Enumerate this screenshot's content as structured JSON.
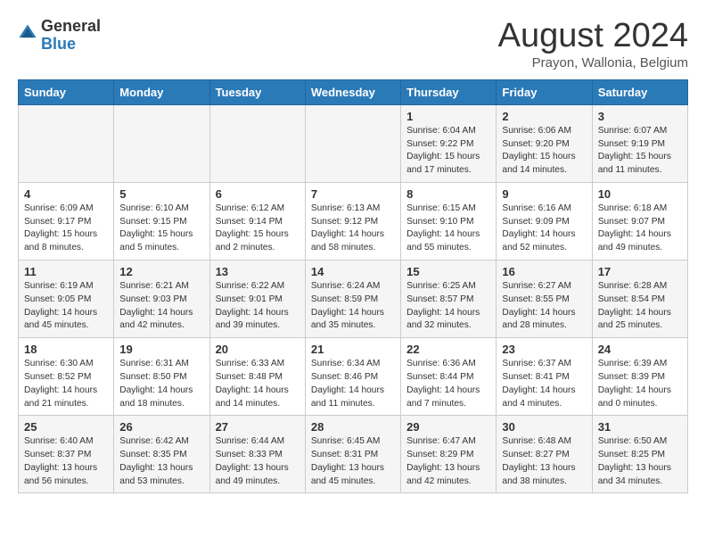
{
  "header": {
    "logo": {
      "general": "General",
      "blue": "Blue"
    },
    "title": "August 2024",
    "subtitle": "Prayon, Wallonia, Belgium"
  },
  "calendar": {
    "weekdays": [
      "Sunday",
      "Monday",
      "Tuesday",
      "Wednesday",
      "Thursday",
      "Friday",
      "Saturday"
    ],
    "weeks": [
      [
        {
          "day": "",
          "info": ""
        },
        {
          "day": "",
          "info": ""
        },
        {
          "day": "",
          "info": ""
        },
        {
          "day": "",
          "info": ""
        },
        {
          "day": "1",
          "info": "Sunrise: 6:04 AM\nSunset: 9:22 PM\nDaylight: 15 hours\nand 17 minutes."
        },
        {
          "day": "2",
          "info": "Sunrise: 6:06 AM\nSunset: 9:20 PM\nDaylight: 15 hours\nand 14 minutes."
        },
        {
          "day": "3",
          "info": "Sunrise: 6:07 AM\nSunset: 9:19 PM\nDaylight: 15 hours\nand 11 minutes."
        }
      ],
      [
        {
          "day": "4",
          "info": "Sunrise: 6:09 AM\nSunset: 9:17 PM\nDaylight: 15 hours\nand 8 minutes."
        },
        {
          "day": "5",
          "info": "Sunrise: 6:10 AM\nSunset: 9:15 PM\nDaylight: 15 hours\nand 5 minutes."
        },
        {
          "day": "6",
          "info": "Sunrise: 6:12 AM\nSunset: 9:14 PM\nDaylight: 15 hours\nand 2 minutes."
        },
        {
          "day": "7",
          "info": "Sunrise: 6:13 AM\nSunset: 9:12 PM\nDaylight: 14 hours\nand 58 minutes."
        },
        {
          "day": "8",
          "info": "Sunrise: 6:15 AM\nSunset: 9:10 PM\nDaylight: 14 hours\nand 55 minutes."
        },
        {
          "day": "9",
          "info": "Sunrise: 6:16 AM\nSunset: 9:09 PM\nDaylight: 14 hours\nand 52 minutes."
        },
        {
          "day": "10",
          "info": "Sunrise: 6:18 AM\nSunset: 9:07 PM\nDaylight: 14 hours\nand 49 minutes."
        }
      ],
      [
        {
          "day": "11",
          "info": "Sunrise: 6:19 AM\nSunset: 9:05 PM\nDaylight: 14 hours\nand 45 minutes."
        },
        {
          "day": "12",
          "info": "Sunrise: 6:21 AM\nSunset: 9:03 PM\nDaylight: 14 hours\nand 42 minutes."
        },
        {
          "day": "13",
          "info": "Sunrise: 6:22 AM\nSunset: 9:01 PM\nDaylight: 14 hours\nand 39 minutes."
        },
        {
          "day": "14",
          "info": "Sunrise: 6:24 AM\nSunset: 8:59 PM\nDaylight: 14 hours\nand 35 minutes."
        },
        {
          "day": "15",
          "info": "Sunrise: 6:25 AM\nSunset: 8:57 PM\nDaylight: 14 hours\nand 32 minutes."
        },
        {
          "day": "16",
          "info": "Sunrise: 6:27 AM\nSunset: 8:55 PM\nDaylight: 14 hours\nand 28 minutes."
        },
        {
          "day": "17",
          "info": "Sunrise: 6:28 AM\nSunset: 8:54 PM\nDaylight: 14 hours\nand 25 minutes."
        }
      ],
      [
        {
          "day": "18",
          "info": "Sunrise: 6:30 AM\nSunset: 8:52 PM\nDaylight: 14 hours\nand 21 minutes."
        },
        {
          "day": "19",
          "info": "Sunrise: 6:31 AM\nSunset: 8:50 PM\nDaylight: 14 hours\nand 18 minutes."
        },
        {
          "day": "20",
          "info": "Sunrise: 6:33 AM\nSunset: 8:48 PM\nDaylight: 14 hours\nand 14 minutes."
        },
        {
          "day": "21",
          "info": "Sunrise: 6:34 AM\nSunset: 8:46 PM\nDaylight: 14 hours\nand 11 minutes."
        },
        {
          "day": "22",
          "info": "Sunrise: 6:36 AM\nSunset: 8:44 PM\nDaylight: 14 hours\nand 7 minutes."
        },
        {
          "day": "23",
          "info": "Sunrise: 6:37 AM\nSunset: 8:41 PM\nDaylight: 14 hours\nand 4 minutes."
        },
        {
          "day": "24",
          "info": "Sunrise: 6:39 AM\nSunset: 8:39 PM\nDaylight: 14 hours\nand 0 minutes."
        }
      ],
      [
        {
          "day": "25",
          "info": "Sunrise: 6:40 AM\nSunset: 8:37 PM\nDaylight: 13 hours\nand 56 minutes."
        },
        {
          "day": "26",
          "info": "Sunrise: 6:42 AM\nSunset: 8:35 PM\nDaylight: 13 hours\nand 53 minutes."
        },
        {
          "day": "27",
          "info": "Sunrise: 6:44 AM\nSunset: 8:33 PM\nDaylight: 13 hours\nand 49 minutes."
        },
        {
          "day": "28",
          "info": "Sunrise: 6:45 AM\nSunset: 8:31 PM\nDaylight: 13 hours\nand 45 minutes."
        },
        {
          "day": "29",
          "info": "Sunrise: 6:47 AM\nSunset: 8:29 PM\nDaylight: 13 hours\nand 42 minutes."
        },
        {
          "day": "30",
          "info": "Sunrise: 6:48 AM\nSunset: 8:27 PM\nDaylight: 13 hours\nand 38 minutes."
        },
        {
          "day": "31",
          "info": "Sunrise: 6:50 AM\nSunset: 8:25 PM\nDaylight: 13 hours\nand 34 minutes."
        }
      ]
    ]
  }
}
